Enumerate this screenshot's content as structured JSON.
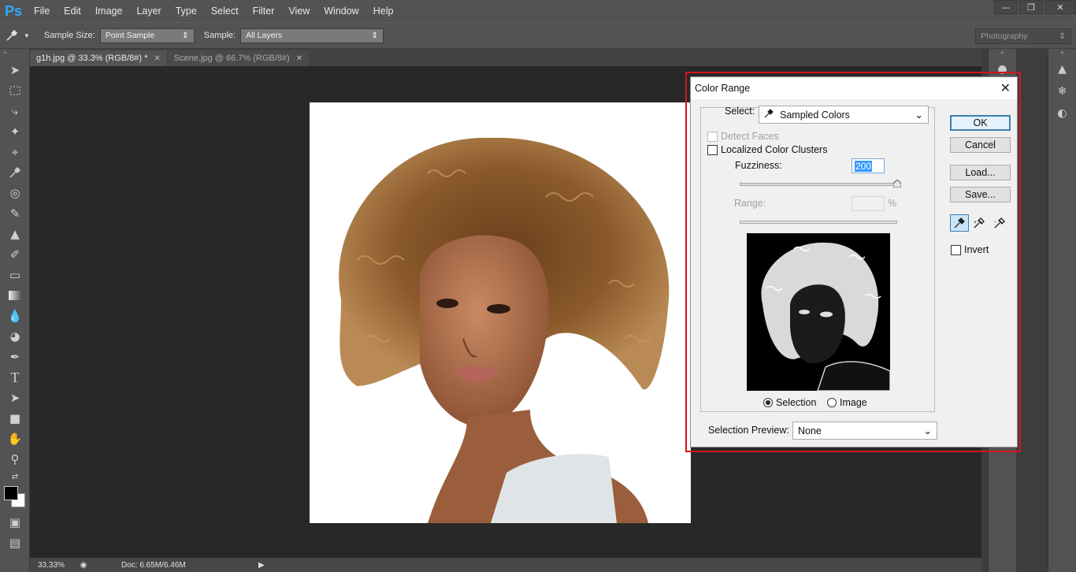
{
  "app": {
    "logo": "Ps"
  },
  "menu": [
    "File",
    "Edit",
    "Image",
    "Layer",
    "Type",
    "Select",
    "Filter",
    "View",
    "Window",
    "Help"
  ],
  "options_bar": {
    "sample_size_label": "Sample Size:",
    "sample_size_value": "Point Sample",
    "sample_label": "Sample:",
    "sample_value": "All Layers",
    "workspace": "Photography"
  },
  "tabs": [
    {
      "label": "g1h.jpg @ 33.3% (RGB/8#) *",
      "active": true
    },
    {
      "label": "Scene.jpg @ 66.7% (RGB/8#)",
      "active": false
    }
  ],
  "status": {
    "zoom": "33.33%",
    "doc": "Doc: 6.65M/6.46M"
  },
  "dialog": {
    "title": "Color Range",
    "select_label": "Select:",
    "select_value": "Sampled Colors",
    "detect_faces": "Detect Faces",
    "localized": "Localized Color Clusters",
    "fuzziness_label": "Fuzziness:",
    "fuzziness_value": "200",
    "fuzziness_level": 1.0,
    "range_label": "Range:",
    "range_unit": "%",
    "radio_selection": "Selection",
    "radio_image": "Image",
    "preview_label": "Selection Preview:",
    "preview_value": "None",
    "buttons": {
      "ok": "OK",
      "cancel": "Cancel",
      "load": "Load...",
      "save": "Save..."
    },
    "invert": "Invert"
  },
  "colors": {
    "accent": "#31a8ff",
    "highlight": "#d1161c",
    "panel": "#535353"
  }
}
